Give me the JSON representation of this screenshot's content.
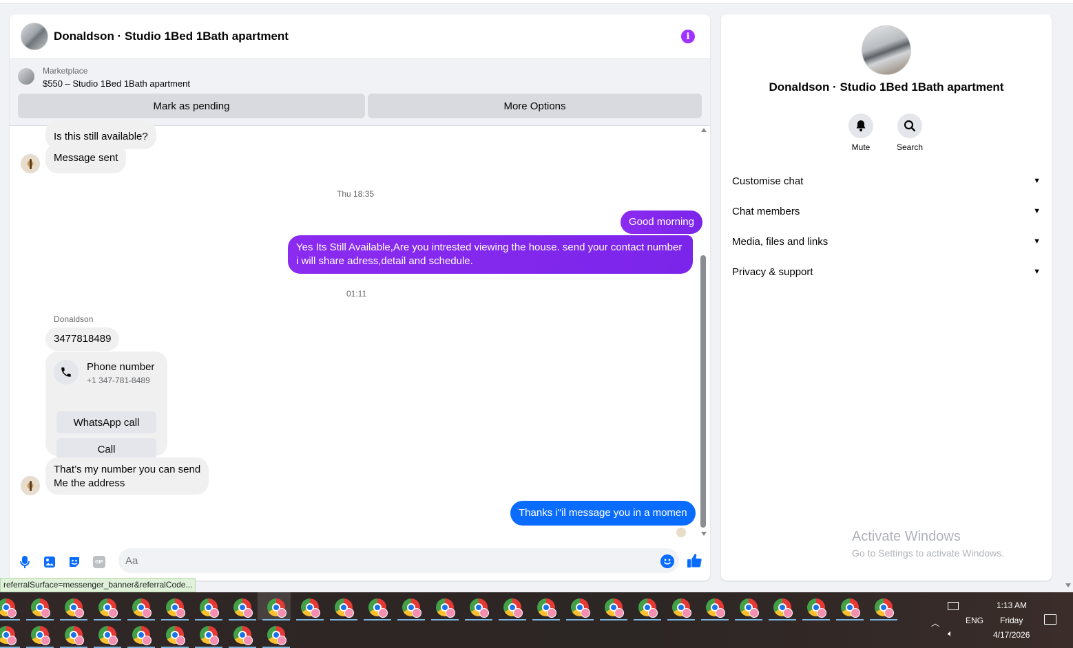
{
  "chat": {
    "title": "Donaldson · Studio 1Bed 1Bath apartment",
    "marketplace_label": "Marketplace",
    "marketplace_price": "$550 – Studio 1Bed 1Bath apartment",
    "mark_pending": "Mark as pending",
    "more_options": "More Options",
    "messages": {
      "m1": "Is this still available?",
      "m2": "Message sent",
      "ts1": "Thu 18:35",
      "m3": "Good morning",
      "m4": "Yes Its Still Available,Are you intrested viewing the house. send your contact number i will share adress,detail and schedule.",
      "ts2": "01:11",
      "sender": "Donaldson",
      "m5": "3477818489",
      "phone_title": "Phone number",
      "phone_number": "+1 347-781-8489",
      "whatsapp_call": "WhatsApp call",
      "call": "Call",
      "m6_line1": "That’s my number you can send",
      "m6_line2": "Me the address",
      "m7": "Thanks i\"il message you in a momen"
    },
    "composer": {
      "placeholder": "Aa",
      "gif_label": "GIF"
    },
    "accent_purple": "#8b2bf0",
    "accent_blue": "#0a6cff"
  },
  "info": {
    "name": "Donaldson · Studio 1Bed 1Bath apartment",
    "mute": "Mute",
    "search": "Search",
    "sections": [
      "Customise chat",
      "Chat members",
      "Media, files and links",
      "Privacy & support"
    ],
    "activate_title": "Activate Windows",
    "activate_sub": "Go to Settings to activate Windows."
  },
  "status_url": "referralSurface=messenger_banner&referralCode...",
  "taskbar": {
    "language": "ENG",
    "time": "1:13 AM",
    "day": "Friday",
    "date": "4/17/2026",
    "icons": [
      "chrome-icon"
    ]
  }
}
